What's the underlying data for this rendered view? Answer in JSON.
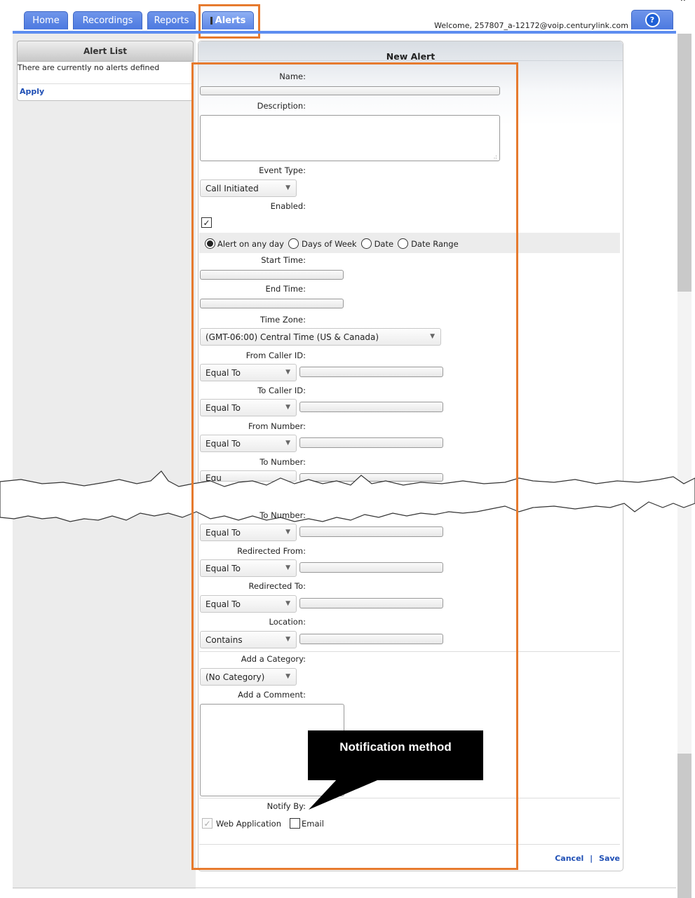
{
  "tabs": [
    {
      "label": "Home"
    },
    {
      "label": "Recordings"
    },
    {
      "label": "Reports"
    },
    {
      "label": "Alerts"
    }
  ],
  "welcome": "Welcome, 257807_a-12172@voip.centurylink.com",
  "help_icon": "?",
  "alert_list": {
    "title": "Alert List",
    "empty_text": "There are currently no alerts defined",
    "apply": "Apply"
  },
  "new_alert": {
    "title": "New Alert",
    "name_label": "Name:",
    "description_label": "Description:",
    "event_type_label": "Event Type:",
    "event_type_value": "Call Initiated",
    "enabled_label": "Enabled:",
    "enabled_checked": true,
    "schedule_options": [
      "Alert on any day",
      "Days of Week",
      "Date",
      "Date Range"
    ],
    "schedule_selected": "Alert on any day",
    "start_time_label": "Start Time:",
    "end_time_label": "End Time:",
    "time_zone_label": "Time Zone:",
    "time_zone_value": "(GMT-06:00) Central Time (US & Canada)",
    "from_caller_id_label": "From Caller ID:",
    "from_caller_id_op": "Equal To",
    "to_caller_id_label": "To Caller ID:",
    "to_caller_id_op": "Equal To",
    "from_number_label": "From Number:",
    "from_number_op": "Equal To",
    "to_number_label": "To Number:",
    "to_number_op_partial": "Equ",
    "to_number_op": "Equal To",
    "redirected_from_label": "Redirected From:",
    "redirected_from_op": "Equal To",
    "redirected_to_label": "Redirected To:",
    "redirected_to_op": "Equal To",
    "location_label": "Location:",
    "location_op": "Contains",
    "category_label": "Add a Category:",
    "category_value": "(No Category)",
    "comment_label": "Add a Comment:",
    "notify_by_label": "Notify By:",
    "notify_options": [
      {
        "label": "Web Application",
        "checked": true,
        "disabled": true
      },
      {
        "label": "Email",
        "checked": false,
        "disabled": false
      }
    ],
    "cancel": "Cancel",
    "separator": "|",
    "save": "Save"
  },
  "callout": "Notification method",
  "colors": {
    "tab_blue": "#5e8ef0",
    "highlight_orange": "#e67a2e",
    "link_blue": "#1f4fb5"
  }
}
